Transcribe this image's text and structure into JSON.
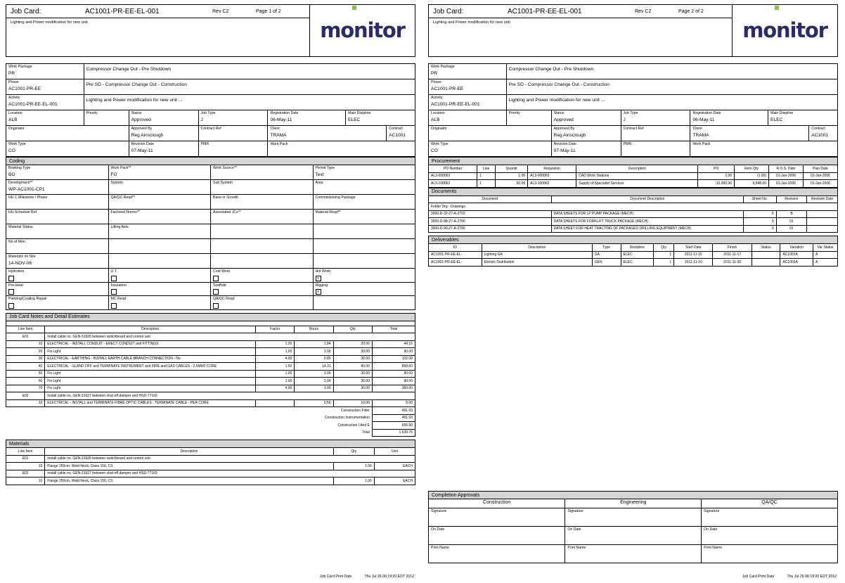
{
  "header": {
    "job_card_label": "Job Card:",
    "job_card_no": "AC1001-PR-EE-EL-001",
    "rev": "Rev C2",
    "page1": "Page 1 of 2",
    "page2": "Page 2 of 2",
    "description": "Lighting and Power modification for new unit",
    "logo_text": "monitor",
    "logo_color": "#2b2b6b",
    "logo_accent": "#8cc63f"
  },
  "info": {
    "work_package_label": "Work Package",
    "work_package_value": "PR",
    "work_package_desc": "Compressor Change Out - Pre Shutdown",
    "phase_label": "Phase",
    "phase_value": "AC1001-PR-EE",
    "phase_desc": "Pre SD - Compressor Change Out - Construction",
    "activity_label": "Activity",
    "activity_value": "AC1001-PR-EE-EL-001",
    "activity_desc": "Lighting and Power modification for new unit ...",
    "location_label": "Location",
    "location_value": "ALB",
    "priority_label": "Priority",
    "priority_value": "",
    "status_label": "Status",
    "status_value": "Approved",
    "job_type_label": "Job Type",
    "job_type_value": "J",
    "registration_date_label": "Registration Date",
    "registration_date_value": "06-May-11",
    "main_discipline_label": "Main Disipline",
    "main_discipline_value": "ELEC",
    "originator_label": "Originator",
    "originator_value": "",
    "approved_by_label": "Approved By",
    "approved_by_value": "Reg Ainsclough",
    "contract_ref_label": "Contract Ref",
    "contract_ref_value": "",
    "client_label": "Client",
    "client_value": "TRAMA",
    "contract_label": "Contract",
    "contract_value": "AC1001",
    "work_type_label": "Work Type",
    "work_type_value": "CO",
    "revision_date_label": "Revision Date",
    "revision_date_value": "07-May-11",
    "pmr_label": "PMR",
    "pmr_value": "",
    "work_pack_label": "Work Pack",
    "work_pack_value": ""
  },
  "coding": {
    "title": "Coding",
    "booking_type_label": "Booking Type",
    "booking_type_value": "BO",
    "work_pack_label": "Work Pack**",
    "work_pack_value": "FG",
    "work_source_label": "Work Source**",
    "work_source_value": "",
    "permit_type_label": "Permit Type",
    "permit_type_value": "Text",
    "development_label": "Development**",
    "development_value": "WP-AC1001-CP1",
    "system_label": "System",
    "system_value": "",
    "sub_system_label": "Sub System",
    "sub_system_value": "",
    "area_label": "Area",
    "area_value": "",
    "hu_milestone_label": "HU C Milestone / Phase",
    "hu_milestone_value": "",
    "qaqc_reqd_label": "QA/QC Reqd**",
    "qaqc_reqd_value": "",
    "base_growth_label": "Base or Growth",
    "base_growth_value": "",
    "commissioning_package_label": "Commissioning Package",
    "commissioning_package_value": "",
    "hu_schedule_label": "HU Schedule Ref",
    "hu_schedule_value": "",
    "factored_norms_label": "Factored Norms**",
    "factored_norms_value": "",
    "associated_jcs_label": "Associated JCs**",
    "associated_jcs_value": "",
    "material_reqd_label": "Material Reqd**",
    "material_reqd_value": "",
    "material_status_label": "Material Status",
    "material_status_value": "",
    "lifting_aids_label": "Lifting Aids",
    "lifting_aids_value": "",
    "no_of_men_label": "No of Men",
    "no_of_men_value": "",
    "materials_on_site_label": "Materials on Site",
    "materials_on_site_value": "14-NOV-06",
    "checkboxes": [
      {
        "label": "Hydrotest",
        "checked": ""
      },
      {
        "label": "U.T.",
        "checked": ""
      },
      {
        "label": "Cold Work",
        "checked": ""
      },
      {
        "label": "Hot Work",
        "checked": "x"
      },
      {
        "label": "Pre-Heat",
        "checked": ""
      },
      {
        "label": "Insulation",
        "checked": ""
      },
      {
        "label": "Scaffold",
        "checked": ""
      },
      {
        "label": "Rigging",
        "checked": "x"
      },
      {
        "label": "Painting/Coating Repair",
        "checked": ""
      },
      {
        "label": "MC Reqd",
        "checked": ""
      },
      {
        "label": "QA/QC Reqd",
        "checked": ""
      }
    ]
  },
  "notes": {
    "title": "Job Card Notes and Detail Estimates",
    "columns": [
      "Line Item",
      "Description",
      "Factor",
      "Hours",
      "Qty",
      "Total"
    ],
    "rows": [
      {
        "kind": "group",
        "item": "E01",
        "desc": "Install cable no. GEN-31926 between switchboard and control unit"
      },
      {
        "kind": "line",
        "item": "10",
        "desc": "ELECTRICAL - INSTALL CONDUIT - ERECT CONDUIT and FITTINGS",
        "factor": "1.20",
        "hours": "1.84",
        "qty": "20.00",
        "total": "44.16"
      },
      {
        "kind": "line",
        "item": "20",
        "desc": "Fix Light",
        "factor": "1.00",
        "hours": "3.00",
        "qty": "30.00",
        "total": "90.00"
      },
      {
        "kind": "line",
        "item": "30",
        "desc": "ELECTRICAL - EARTHING - INSTALL EARTH CABLE BRANCH CONNECTION - No.",
        "factor": "4.00",
        "hours": "0.85",
        "qty": "30.00",
        "total": "102.00"
      },
      {
        "kind": "line",
        "item": "40",
        "desc": "ELECTRICAL - GLAND OFF and TERMINATE INSTRUMENT and FIRE and GAS CABLES - 2.5MM2 CORE",
        "factor": "1.50",
        "hours": "14.31",
        "qty": "40.00",
        "total": "858.60"
      },
      {
        "kind": "line",
        "item": "50",
        "desc": "Fix Light",
        "factor": "1.00",
        "hours": "3.00",
        "qty": "30.00",
        "total": "90.00"
      },
      {
        "kind": "line",
        "item": "60",
        "desc": "Fix Light",
        "factor": "1.00",
        "hours": "3.00",
        "qty": "30.00",
        "total": "90.00"
      },
      {
        "kind": "line",
        "item": "70",
        "desc": "Fix Light",
        "factor": "4.00",
        "hours": "3.00",
        "qty": "30.00",
        "total": "360.00"
      },
      {
        "kind": "group",
        "item": "E02",
        "desc": "Install cable no. GEN-31927 between shut-off damper and HSD-77169"
      },
      {
        "kind": "line",
        "item": "10",
        "desc": "ELECTRICAL - INSTALL and TERMINATE FIBRE OPTIC CABLES - TERMINATE CABLE - PER CORE",
        "factor": "",
        "hours": "0.50",
        "qty": "10.00",
        "total": "5.00"
      }
    ],
    "summary": [
      {
        "label": "Construction Fitter",
        "value": "491.93"
      },
      {
        "label": "Construction Instrumentation",
        "value": "491.93"
      },
      {
        "label": "Construction I And E",
        "value": "655.90"
      },
      {
        "label": "Total",
        "value": "1,639.76"
      }
    ]
  },
  "materials": {
    "title": "Materials",
    "columns": [
      "Line Item",
      "Description",
      "Qty",
      "Unit"
    ],
    "rows": [
      {
        "kind": "group",
        "item": "E01",
        "desc": "Install cable no. GEN-31926 between switchboard and control unit"
      },
      {
        "kind": "line",
        "item": "10",
        "desc": "Flange 250cm; Weld Neck, Class 150, CS",
        "qty": "1.00",
        "unit": "EACH"
      },
      {
        "kind": "group",
        "item": "E02",
        "desc": "Install cable no. GEN-31927 between shut-off damper and HSD-77169"
      },
      {
        "kind": "line",
        "item": "10",
        "desc": "Flange 250cm; Weld Neck, Class 150, CS",
        "qty": "1.00",
        "unit": "EACH"
      }
    ]
  },
  "procurement": {
    "title": "Procurement",
    "columns": [
      "PO Number",
      "Line",
      "Quantit",
      "Requistion",
      "Description",
      "PO",
      "Rem Qty",
      "R.O.S. Date",
      "Plan Date"
    ],
    "rows": [
      {
        "po_number": "AL3-000063",
        "line": "1",
        "quantity": "1.00",
        "requisition": "AL3-000063",
        "description": "CAD Work Stations",
        "po": "2.00",
        "rem_qty": "(1.00)",
        "ros_date": "01-Jan-2006",
        "plan_date": "01-Jan-2006"
      },
      {
        "po_number": "AL3-100062",
        "line": "1",
        "quantity": "50.00",
        "requisition": "AL3-100062",
        "description": "Supply of Specialist Services",
        "po": "10,000.00",
        "rem_qty": "9,848.00",
        "ros_date": "01-Jan-2006",
        "plan_date": "01-Jan-2006"
      }
    ]
  },
  "documents": {
    "title": "Documents",
    "columns": [
      "Document",
      "Documnet Description",
      "Sheet No.",
      "Revision",
      "Revision Date"
    ],
    "folder": "Folder Drg - Drawings",
    "rows": [
      {
        "document": "3000-D-32-27-A-2702",
        "description": "DATA SHEETS FOR LP PUMP PACKAGE (MECH)",
        "sheet_no": "0",
        "revision": "B",
        "revision_date": ""
      },
      {
        "document": "3000-D-88-27-A-2700",
        "description": "DATA SHEETS FOR FORKLIFT TRUCK PACKAGE (MECH)",
        "sheet_no": "0",
        "revision": "01",
        "revision_date": ""
      },
      {
        "document": "3000-D-90-27-A-2700",
        "description": "DATA SHEET FOR HEAT TRACTING OF PACKAGED DRILLING EQUIPMENT (MECH)",
        "sheet_no": "0",
        "revision": "01",
        "revision_date": ""
      }
    ]
  },
  "deliverables": {
    "title": "Deliverables",
    "columns": [
      "ID",
      "Description",
      "Type",
      "Discipline",
      "Qty",
      "Start Date",
      "Finish",
      "Status",
      "Variation",
      "Var Status"
    ],
    "rows": [
      {
        "id": "AC1001-PR-EE-EL-",
        "description": "Lighting GA",
        "type": "GA",
        "discipline": "ELEC",
        "qty": "1",
        "start_date": "2011-11-15",
        "finish": "2011-11-17",
        "status": "",
        "variation": "AC1001A",
        "var_status": "A"
      },
      {
        "id": "AC1001-PR-EE-EL-",
        "description": "Electric Distribution",
        "type": "GEN",
        "discipline": "ELEC",
        "qty": "1",
        "start_date": "2011-11-10",
        "finish": "2011-11-30",
        "status": "",
        "variation": "AC1001A",
        "var_status": "A"
      }
    ]
  },
  "approvals": {
    "title": "Completion Approvals",
    "columns": [
      "Construction",
      "Engineering",
      "QA/QC"
    ],
    "rows": [
      "Signature",
      "On Date",
      "Print Name"
    ]
  },
  "footer": {
    "print_date_label": "Job Card Print Date",
    "print_date_value": "Thu Jul 26 06:19:20 EDT 2012"
  }
}
